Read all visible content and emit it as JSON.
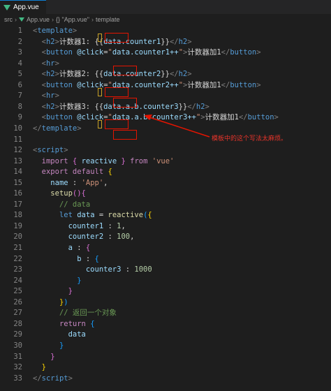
{
  "tab": {
    "label": "App.vue"
  },
  "breadcrumb": [
    "src",
    "App.vue",
    "{} \"App.vue\"",
    "template"
  ],
  "annotation": "模板中的这个写法太麻烦。",
  "lines": [
    {
      "n": "1",
      "tokens": [
        [
          "<",
          "#808080"
        ],
        [
          "template",
          "#569cd6"
        ],
        [
          ">",
          "#808080"
        ]
      ]
    },
    {
      "n": "2",
      "tokens": [
        [
          "  ",
          ""
        ],
        [
          "<",
          "#808080"
        ],
        [
          "h2",
          "#569cd6"
        ],
        [
          ">",
          "#808080"
        ],
        [
          "计数器1: ",
          "#d4d4d4"
        ],
        [
          "{{",
          "#d4d4d4"
        ],
        [
          "data",
          "#9cdcfe"
        ],
        [
          ".counter1",
          "#9cdcfe"
        ],
        [
          "}}",
          "#d4d4d4"
        ],
        [
          "</",
          "#808080"
        ],
        [
          "h2",
          "#569cd6"
        ],
        [
          ">",
          "#808080"
        ]
      ]
    },
    {
      "n": "3",
      "tokens": [
        [
          "  ",
          ""
        ],
        [
          "<",
          "#808080"
        ],
        [
          "button",
          "#569cd6"
        ],
        [
          " ",
          ""
        ],
        [
          "@click",
          "#9cdcfe"
        ],
        [
          "=",
          "#d4d4d4"
        ],
        [
          "\"",
          "#ce9178"
        ],
        [
          "data",
          "#9cdcfe"
        ],
        [
          ".counter1++",
          "#9cdcfe"
        ],
        [
          "\"",
          "#ce9178"
        ],
        [
          ">",
          "#808080"
        ],
        [
          "计数器加1",
          "#d4d4d4"
        ],
        [
          "</",
          "#808080"
        ],
        [
          "button",
          "#569cd6"
        ],
        [
          ">",
          "#808080"
        ]
      ]
    },
    {
      "n": "4",
      "tokens": [
        [
          "  ",
          ""
        ],
        [
          "<",
          "#808080"
        ],
        [
          "hr",
          "#569cd6"
        ],
        [
          ">",
          "#808080"
        ]
      ]
    },
    {
      "n": "5",
      "tokens": [
        [
          "  ",
          ""
        ],
        [
          "<",
          "#808080"
        ],
        [
          "h2",
          "#569cd6"
        ],
        [
          ">",
          "#808080"
        ],
        [
          "计数器2: ",
          "#d4d4d4"
        ],
        [
          "{{",
          "#d4d4d4"
        ],
        [
          "data",
          "#9cdcfe"
        ],
        [
          ".counter2",
          "#9cdcfe"
        ],
        [
          "}}",
          "#d4d4d4"
        ],
        [
          "</",
          "#808080"
        ],
        [
          "h2",
          "#569cd6"
        ],
        [
          ">",
          "#808080"
        ]
      ]
    },
    {
      "n": "6",
      "tokens": [
        [
          "  ",
          ""
        ],
        [
          "<",
          "#808080"
        ],
        [
          "button",
          "#569cd6"
        ],
        [
          " ",
          ""
        ],
        [
          "@click",
          "#9cdcfe"
        ],
        [
          "=",
          "#d4d4d4"
        ],
        [
          "\"",
          "#ce9178"
        ],
        [
          "data",
          "#9cdcfe"
        ],
        [
          ".counter2++",
          "#9cdcfe"
        ],
        [
          "\"",
          "#ce9178"
        ],
        [
          ">",
          "#808080"
        ],
        [
          "计数器加1",
          "#d4d4d4"
        ],
        [
          "</",
          "#808080"
        ],
        [
          "button",
          "#569cd6"
        ],
        [
          ">",
          "#808080"
        ]
      ]
    },
    {
      "n": "7",
      "tokens": [
        [
          "  ",
          ""
        ],
        [
          "<",
          "#808080"
        ],
        [
          "hr",
          "#569cd6"
        ],
        [
          ">",
          "#808080"
        ]
      ]
    },
    {
      "n": "8",
      "tokens": [
        [
          "  ",
          ""
        ],
        [
          "<",
          "#808080"
        ],
        [
          "h2",
          "#569cd6"
        ],
        [
          ">",
          "#808080"
        ],
        [
          "计数器3: ",
          "#d4d4d4"
        ],
        [
          "{{",
          "#d4d4d4"
        ],
        [
          "data",
          "#9cdcfe"
        ],
        [
          ".a.b.counter3",
          "#9cdcfe"
        ],
        [
          "}}",
          "#d4d4d4"
        ],
        [
          "</",
          "#808080"
        ],
        [
          "h2",
          "#569cd6"
        ],
        [
          ">",
          "#808080"
        ]
      ]
    },
    {
      "n": "9",
      "tokens": [
        [
          "  ",
          ""
        ],
        [
          "<",
          "#808080"
        ],
        [
          "button",
          "#569cd6"
        ],
        [
          " ",
          ""
        ],
        [
          "@click",
          "#9cdcfe"
        ],
        [
          "=",
          "#d4d4d4"
        ],
        [
          "\"",
          "#ce9178"
        ],
        [
          "data",
          "#9cdcfe"
        ],
        [
          ".a.b.counter3++",
          "#9cdcfe"
        ],
        [
          "\"",
          "#ce9178"
        ],
        [
          ">",
          "#808080"
        ],
        [
          "计数器加1",
          "#d4d4d4"
        ],
        [
          "</",
          "#808080"
        ],
        [
          "button",
          "#569cd6"
        ],
        [
          ">",
          "#808080"
        ]
      ]
    },
    {
      "n": "10",
      "tokens": [
        [
          "</",
          "#808080"
        ],
        [
          "template",
          "#569cd6"
        ],
        [
          ">",
          "#808080"
        ]
      ]
    },
    {
      "n": "11",
      "tokens": []
    },
    {
      "n": "12",
      "tokens": [
        [
          "<",
          "#808080"
        ],
        [
          "script",
          "#569cd6"
        ],
        [
          ">",
          "#808080"
        ]
      ]
    },
    {
      "n": "13",
      "tokens": [
        [
          "  ",
          ""
        ],
        [
          "import",
          "#c586c0"
        ],
        [
          " ",
          ""
        ],
        [
          "{",
          "#da70d6"
        ],
        [
          " reactive ",
          "#9cdcfe"
        ],
        [
          "}",
          "#da70d6"
        ],
        [
          " ",
          ""
        ],
        [
          "from",
          "#c586c0"
        ],
        [
          " ",
          ""
        ],
        [
          "'vue'",
          "#ce9178"
        ]
      ]
    },
    {
      "n": "14",
      "tokens": [
        [
          "  ",
          ""
        ],
        [
          "export",
          "#c586c0"
        ],
        [
          " ",
          ""
        ],
        [
          "default",
          "#c586c0"
        ],
        [
          " ",
          ""
        ],
        [
          "{",
          "#ffd700"
        ]
      ]
    },
    {
      "n": "15",
      "tokens": [
        [
          "    ",
          ""
        ],
        [
          "name",
          "#9cdcfe"
        ],
        [
          " : ",
          "#d4d4d4"
        ],
        [
          "'App'",
          "#ce9178"
        ],
        [
          ",",
          "#d4d4d4"
        ]
      ]
    },
    {
      "n": "16",
      "tokens": [
        [
          "    ",
          ""
        ],
        [
          "setup",
          "#dcdcaa"
        ],
        [
          "(){",
          "#da70d6"
        ]
      ]
    },
    {
      "n": "17",
      "tokens": [
        [
          "      ",
          ""
        ],
        [
          "// data",
          "#6a9955"
        ]
      ]
    },
    {
      "n": "18",
      "tokens": [
        [
          "      ",
          ""
        ],
        [
          "let",
          "#569cd6"
        ],
        [
          " ",
          ""
        ],
        [
          "data",
          "#9cdcfe"
        ],
        [
          " = ",
          "#d4d4d4"
        ],
        [
          "reactive",
          "#dcdcaa"
        ],
        [
          "(",
          "#179fff"
        ],
        [
          "{",
          "#ffd700"
        ]
      ]
    },
    {
      "n": "19",
      "tokens": [
        [
          "        ",
          ""
        ],
        [
          "counter1",
          "#9cdcfe"
        ],
        [
          " : ",
          "#d4d4d4"
        ],
        [
          "1",
          "#b5cea8"
        ],
        [
          ",",
          "#d4d4d4"
        ]
      ]
    },
    {
      "n": "20",
      "tokens": [
        [
          "        ",
          ""
        ],
        [
          "counter2",
          "#9cdcfe"
        ],
        [
          " : ",
          "#d4d4d4"
        ],
        [
          "100",
          "#b5cea8"
        ],
        [
          ",",
          "#d4d4d4"
        ]
      ]
    },
    {
      "n": "21",
      "tokens": [
        [
          "        ",
          ""
        ],
        [
          "a",
          "#9cdcfe"
        ],
        [
          " : ",
          "#d4d4d4"
        ],
        [
          "{",
          "#da70d6"
        ]
      ]
    },
    {
      "n": "22",
      "tokens": [
        [
          "          ",
          ""
        ],
        [
          "b",
          "#9cdcfe"
        ],
        [
          " : ",
          "#d4d4d4"
        ],
        [
          "{",
          "#179fff"
        ]
      ]
    },
    {
      "n": "23",
      "tokens": [
        [
          "            ",
          ""
        ],
        [
          "counter3",
          "#9cdcfe"
        ],
        [
          " : ",
          "#d4d4d4"
        ],
        [
          "1000",
          "#b5cea8"
        ]
      ]
    },
    {
      "n": "24",
      "tokens": [
        [
          "          ",
          ""
        ],
        [
          "}",
          "#179fff"
        ]
      ]
    },
    {
      "n": "25",
      "tokens": [
        [
          "        ",
          ""
        ],
        [
          "}",
          "#da70d6"
        ]
      ]
    },
    {
      "n": "26",
      "tokens": [
        [
          "      ",
          ""
        ],
        [
          "}",
          "#ffd700"
        ],
        [
          ")",
          "#179fff"
        ]
      ]
    },
    {
      "n": "27",
      "tokens": [
        [
          "      ",
          ""
        ],
        [
          "// 返回一个对象",
          "#6a9955"
        ]
      ]
    },
    {
      "n": "28",
      "tokens": [
        [
          "      ",
          ""
        ],
        [
          "return",
          "#c586c0"
        ],
        [
          " ",
          ""
        ],
        [
          "{",
          "#179fff"
        ]
      ]
    },
    {
      "n": "29",
      "tokens": [
        [
          "        ",
          ""
        ],
        [
          "data",
          "#9cdcfe"
        ]
      ]
    },
    {
      "n": "30",
      "tokens": [
        [
          "      ",
          ""
        ],
        [
          "}",
          "#179fff"
        ]
      ]
    },
    {
      "n": "31",
      "tokens": [
        [
          "    ",
          ""
        ],
        [
          "}",
          "#da70d6"
        ]
      ]
    },
    {
      "n": "32",
      "tokens": [
        [
          "  ",
          ""
        ],
        [
          "}",
          "#ffd700"
        ]
      ]
    },
    {
      "n": "33",
      "tokens": [
        [
          "</",
          "#808080"
        ],
        [
          "script",
          "#569cd6"
        ],
        [
          ">",
          "#808080"
        ]
      ]
    }
  ]
}
